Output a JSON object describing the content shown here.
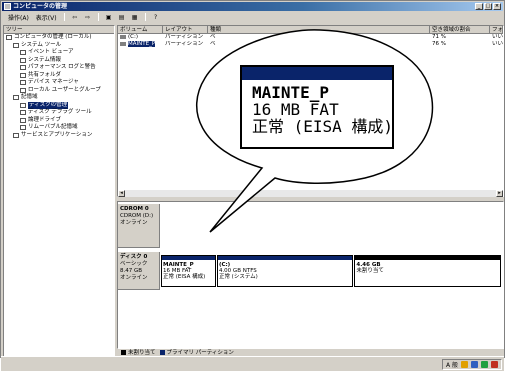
{
  "window": {
    "title": "コンピュータの管理",
    "controls": [
      "_",
      "□",
      "×"
    ]
  },
  "menubar": {
    "items": [
      "操作(A)",
      "表示(V)"
    ]
  },
  "tree": {
    "header": "ツリー",
    "nodes": [
      {
        "label": "コンピュータの管理 (ローカル)",
        "indent": 0
      },
      {
        "label": "システム ツール",
        "indent": 1
      },
      {
        "label": "イベント ビューア",
        "indent": 2
      },
      {
        "label": "システム情報",
        "indent": 2
      },
      {
        "label": "パフォーマンス ログと警告",
        "indent": 2
      },
      {
        "label": "共有フォルダ",
        "indent": 2
      },
      {
        "label": "デバイス マネージャ",
        "indent": 2
      },
      {
        "label": "ローカル ユーザーとグループ",
        "indent": 2
      },
      {
        "label": "記憶域",
        "indent": 1
      },
      {
        "label": "ディスクの管理",
        "indent": 2,
        "selected": true
      },
      {
        "label": "ディスク デフラグ ツール",
        "indent": 2
      },
      {
        "label": "論理ドライブ",
        "indent": 2
      },
      {
        "label": "リムーバブル記憶域",
        "indent": 2
      },
      {
        "label": "サービスとアプリケーション",
        "indent": 1
      }
    ]
  },
  "volume_list": {
    "columns": [
      "ボリューム",
      "レイアウト",
      "種類",
      "空き領域の割合",
      "フォ"
    ],
    "rows": [
      {
        "volume": "(C:)",
        "layout": "パーティション",
        "type": "ベ",
        "free_pct": "71 %",
        "ft": "いい"
      },
      {
        "volume": "MAINTE_P",
        "layout": "パーティション",
        "type": "ベ",
        "free_pct": "76 %",
        "ft": "いい",
        "selected": true
      }
    ]
  },
  "disks": [
    {
      "name": "CDROM 0",
      "lines": [
        "CDROM (D:)",
        "",
        "オンライン"
      ],
      "partitions": []
    },
    {
      "name": "ディスク 0",
      "lines": [
        "ベーシック",
        "8.47 GB",
        "オンライン"
      ],
      "partitions": [
        {
          "lines": [
            "MAINTE_P",
            "16 MB FAT",
            "正常 (EISA 構成)"
          ],
          "color": "#0a246a",
          "flex": 1
        },
        {
          "lines": [
            "(C:)",
            "4.00 GB NTFS",
            "正常 (システム)"
          ],
          "color": "#0a246a",
          "flex": 2.6
        },
        {
          "lines": [
            "4.46 GB",
            "未割り当て",
            ""
          ],
          "color": "#000000",
          "flex": 2.8
        }
      ]
    }
  ],
  "legend": [
    {
      "label": "未割り当て",
      "color": "#000000"
    },
    {
      "label": "プライマリ パーティション",
      "color": "#0a246a"
    }
  ],
  "callout": {
    "lines": [
      "MAINTE_P",
      "16 MB FAT",
      "正常 (EISA 構成)"
    ]
  },
  "tray": {
    "ime": "A 般"
  }
}
